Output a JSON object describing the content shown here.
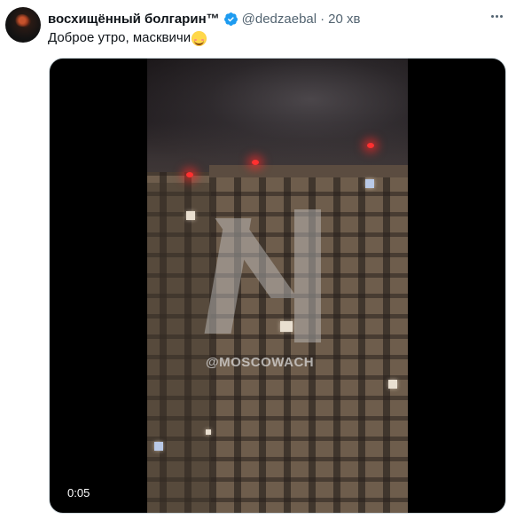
{
  "tweet": {
    "author_name": "восхищённый болгарин™",
    "handle": "@dedzaebal",
    "separator": "·",
    "time_ago": "20 хв",
    "text": "Доброе утро, масквичи",
    "emoji_icon": "smiling-face-emoji",
    "verified_color": "#1d9bf0"
  },
  "media": {
    "watermark": "@MOSCOWACH",
    "duration": "0:05"
  }
}
